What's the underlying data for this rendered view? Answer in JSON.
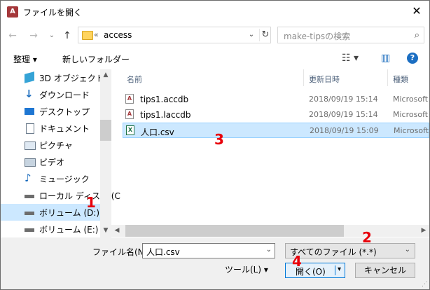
{
  "window": {
    "title": "ファイルを開く",
    "close_glyph": "✕",
    "app_icon_letter": "A"
  },
  "nav": {
    "back_glyph": "←",
    "forward_glyph": "→",
    "recent_glyph": "⌄",
    "up_glyph": "↑",
    "address_crumb": "«",
    "address_text": "access",
    "address_drop_glyph": "⌄",
    "refresh_glyph": "↻",
    "search_placeholder": "make-tipsの検索",
    "search_glyph": "⌕"
  },
  "toolbar": {
    "organize_label": "整理 ▾",
    "new_folder_label": "新しいフォルダー",
    "view_glyph": "☷ ▾",
    "pane_glyph": "▥",
    "help_glyph": "?"
  },
  "sidebar": {
    "items": [
      {
        "label": "3D オブジェクト",
        "icon": "cube-icon"
      },
      {
        "label": "ダウンロード",
        "icon": "download-icon"
      },
      {
        "label": "デスクトップ",
        "icon": "desktop-icon"
      },
      {
        "label": "ドキュメント",
        "icon": "document-icon"
      },
      {
        "label": "ピクチャ",
        "icon": "picture-icon"
      },
      {
        "label": "ビデオ",
        "icon": "video-icon"
      },
      {
        "label": "ミュージック",
        "icon": "music-icon"
      },
      {
        "label": "ローカル ディスク (C",
        "icon": "drive-icon"
      },
      {
        "label": "ボリューム (D:)",
        "icon": "drive-icon"
      },
      {
        "label": "ボリューム (E:)",
        "icon": "drive-icon"
      }
    ],
    "scroll_up_glyph": "▲",
    "scroll_down_glyph": "▼"
  },
  "columns": {
    "name": "名前",
    "date": "更新日時",
    "type": "種類"
  },
  "files": [
    {
      "name": "tips1.accdb",
      "date": "2018/09/19 15:14",
      "type": "Microsoft",
      "icon_letter": "A"
    },
    {
      "name": "tips1.laccdb",
      "date": "2018/09/19 15:14",
      "type": "Microsoft",
      "icon_letter": "A"
    },
    {
      "name": "人口.csv",
      "date": "2018/09/19 15:09",
      "type": "Microsoft",
      "icon_letter": "X"
    }
  ],
  "hscroll": {
    "left_glyph": "◀",
    "right_glyph": "▶"
  },
  "bottom": {
    "filename_label": "ファイル名(N):",
    "filename_value": "人口.csv",
    "filename_drop_glyph": "⌄",
    "filetype_value": "すべてのファイル (*.*)",
    "filetype_drop_glyph": "⌄",
    "tools_label": "ツール(L)  ▾",
    "open_label": "開く(O)",
    "open_drop_glyph": "▾",
    "cancel_label": "キャンセル",
    "grip_glyph": "⋰"
  },
  "annotations": [
    "1",
    "2",
    "3",
    "4"
  ],
  "colors": {
    "selection": "#cce8ff",
    "accent": "#0078d7",
    "marker": "#e8000b"
  }
}
